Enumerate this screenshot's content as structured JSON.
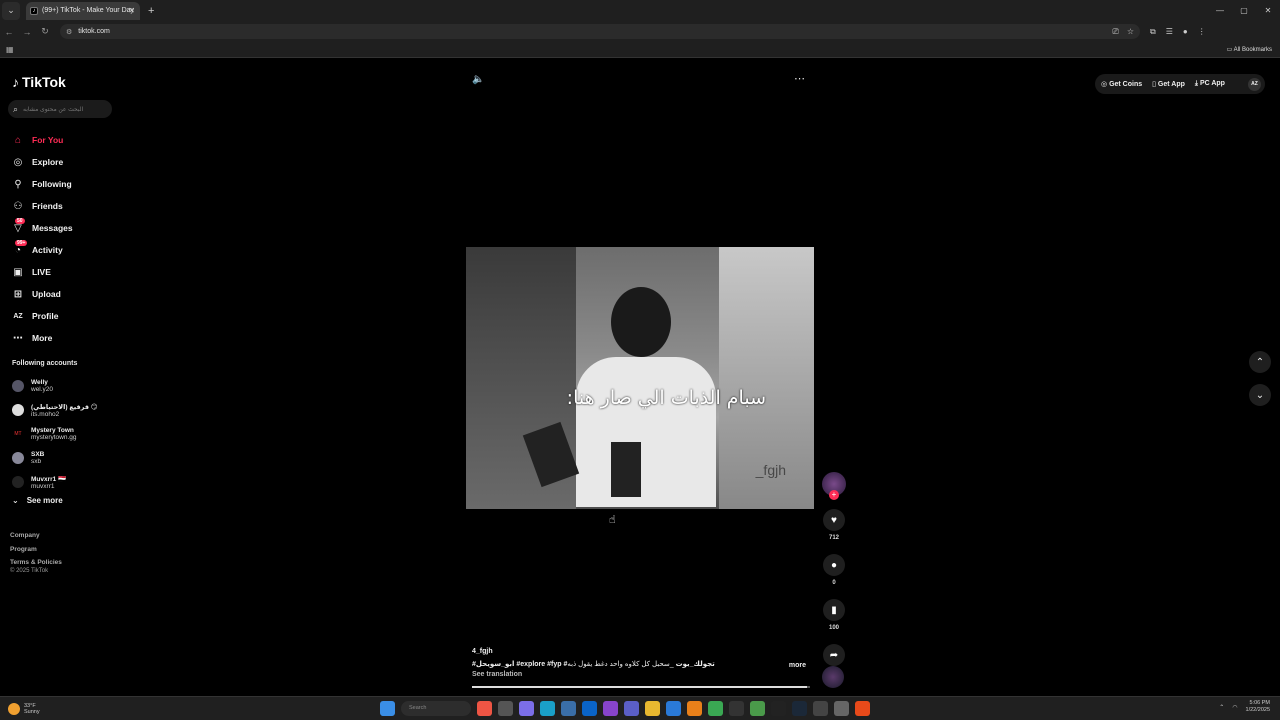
{
  "browser": {
    "tab_title": "(99+) TikTok - Make Your Day",
    "url": "tiktok.com",
    "all_bookmarks": "All Bookmarks"
  },
  "sidebar": {
    "logo": "TikTok",
    "search_placeholder": "البحث عن محتوى مشابه",
    "nav": [
      {
        "label": "For You",
        "icon": "home-icon"
      },
      {
        "label": "Explore",
        "icon": "compass-icon"
      },
      {
        "label": "Following",
        "icon": "person-icon"
      },
      {
        "label": "Friends",
        "icon": "friends-icon"
      },
      {
        "label": "Messages",
        "icon": "send-icon",
        "badge": "50"
      },
      {
        "label": "Activity",
        "icon": "bell-icon",
        "badge": "99+"
      },
      {
        "label": "LIVE",
        "icon": "live-icon"
      },
      {
        "label": "Upload",
        "icon": "upload-icon"
      },
      {
        "label": "Profile",
        "icon": "profile-icon"
      },
      {
        "label": "More",
        "icon": "dots-icon"
      }
    ],
    "following_title": "Following accounts",
    "accounts": [
      {
        "name": "Welly",
        "handle": "wel.y20"
      },
      {
        "name": "قرقيع (الاحتياطي) 😏",
        "handle": "its.moho2"
      },
      {
        "name": "Mystery Town",
        "handle": "mysterytown.gg"
      },
      {
        "name": "SXB",
        "handle": "sxb"
      },
      {
        "name": "Muvxrr1 🇾🇪",
        "handle": "muvxrr1"
      }
    ],
    "see_more": "See more",
    "footer": [
      "Company",
      "Program",
      "Terms & Policies"
    ],
    "copyright": "© 2025 TikTok"
  },
  "topbar": {
    "get_coins": "Get Coins",
    "get_app": "Get App",
    "pc_app": "PC App",
    "avatar": "AZ"
  },
  "video": {
    "overlay_text": "سبام الذبات الي صار هنا:",
    "watermark": "_fgjh",
    "author": "4_fgjh",
    "desc_tags": "#ابو_سويحل #explore #fyp #تجولك_بوت",
    "desc_text": "_سحبل كل كلاوه واحد دغط يقول ذبه",
    "more": "more",
    "translate": "See translation",
    "progress": 0.99
  },
  "actions": {
    "likes": "712",
    "comments": "0",
    "saves": "100",
    "shares": "170"
  },
  "taskbar": {
    "weather_temp": "33°F",
    "weather_desc": "Sunny",
    "search": "Search",
    "time": "5:06 PM",
    "date": "1/22/2025"
  }
}
